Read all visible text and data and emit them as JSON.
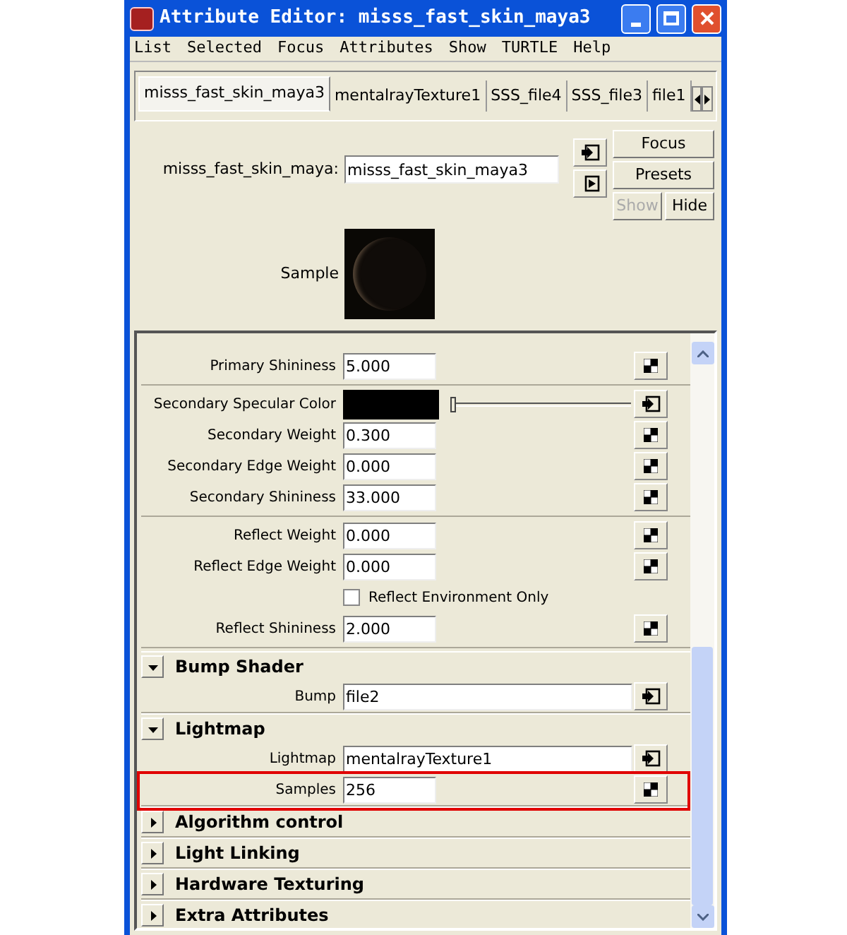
{
  "window": {
    "title": "Attribute Editor: misss_fast_skin_maya3"
  },
  "menu": [
    "List",
    "Selected",
    "Focus",
    "Attributes",
    "Show",
    "TURTLE",
    "Help"
  ],
  "tabs": [
    {
      "label": "misss_fast_skin_maya3",
      "selected": true
    },
    {
      "label": "mentalrayTexture1",
      "selected": false
    },
    {
      "label": "SSS_file4",
      "selected": false
    },
    {
      "label": "SSS_file3",
      "selected": false
    },
    {
      "label": "file1",
      "selected": false
    }
  ],
  "node": {
    "label": "misss_fast_skin_maya:",
    "value": "misss_fast_skin_maya3"
  },
  "side_buttons": [
    {
      "label": "Focus",
      "disabled": false
    },
    {
      "label": "Presets",
      "disabled": false
    },
    {
      "label": "Show",
      "disabled": true
    },
    {
      "label": "Hide",
      "disabled": false
    }
  ],
  "sample": {
    "label": "Sample"
  },
  "groups": [
    {
      "rows": [
        {
          "kind": "number",
          "label": "Primary Shininess",
          "value": "5.000",
          "highlighted": false
        }
      ]
    },
    {
      "rows": [
        {
          "kind": "color",
          "label": "Secondary Specular Color",
          "level": 0,
          "highlighted": false
        },
        {
          "kind": "number",
          "label": "Secondary Weight",
          "value": "0.300",
          "highlighted": false
        },
        {
          "kind": "number",
          "label": "Secondary Edge Weight",
          "value": "0.000",
          "highlighted": false
        },
        {
          "kind": "number",
          "label": "Secondary Shininess",
          "value": "33.000",
          "highlighted": false
        }
      ]
    },
    {
      "rows": [
        {
          "kind": "number",
          "label": "Reflect Weight",
          "value": "0.000",
          "highlighted": false
        },
        {
          "kind": "number",
          "label": "Reflect Edge Weight",
          "value": "0.000",
          "highlighted": false
        },
        {
          "kind": "checkbox",
          "label": "Reflect Environment Only",
          "checked": false,
          "highlighted": false
        },
        {
          "kind": "number",
          "label": "Reflect Shininess",
          "value": "2.000",
          "highlighted": false
        }
      ]
    }
  ],
  "sections": [
    {
      "title": "Bump Shader",
      "expanded": true,
      "rows": [
        {
          "kind": "link",
          "label": "Bump",
          "value": "file2",
          "highlighted": false
        }
      ]
    },
    {
      "title": "Lightmap",
      "expanded": true,
      "rows": [
        {
          "kind": "link",
          "label": "Lightmap",
          "value": "mentalrayTexture1",
          "highlighted": false
        },
        {
          "kind": "number",
          "label": "Samples",
          "value": "256",
          "highlighted": true
        }
      ]
    },
    {
      "title": "Algorithm control",
      "expanded": false
    },
    {
      "title": "Light Linking",
      "expanded": false
    },
    {
      "title": "Hardware Texturing",
      "expanded": false
    },
    {
      "title": "Extra Attributes",
      "expanded": false
    }
  ]
}
